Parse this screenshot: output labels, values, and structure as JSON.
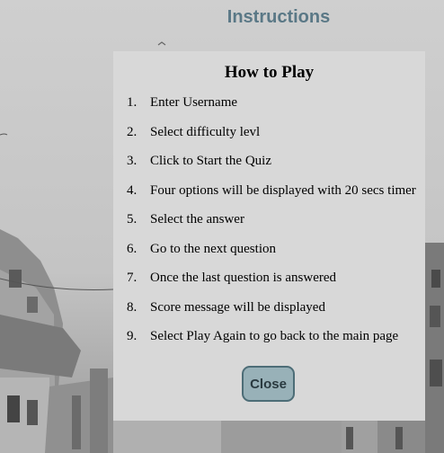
{
  "page": {
    "title": "Instructions"
  },
  "modal": {
    "title": "How to Play",
    "steps": [
      {
        "num": "1.",
        "text": "Enter Username"
      },
      {
        "num": "2.",
        "text": "Select difficulty levl"
      },
      {
        "num": "3.",
        "text": "Click to Start the Quiz"
      },
      {
        "num": "4.",
        "text": "Four options will be displayed with 20 secs timer"
      },
      {
        "num": "5.",
        "text": "Select the answer"
      },
      {
        "num": "6.",
        "text": "Go to the next question"
      },
      {
        "num": "7.",
        "text": "Once the last question is answered"
      },
      {
        "num": "8.",
        "text": "Score message will be displayed"
      },
      {
        "num": "9.",
        "text": "Select Play Again to go back to the main page"
      }
    ],
    "close_label": "Close"
  },
  "colors": {
    "title": "#5a7886",
    "modal_bg": "#d8d8d8",
    "button_bg": "#98b1b8",
    "button_border": "#4d6d77"
  }
}
